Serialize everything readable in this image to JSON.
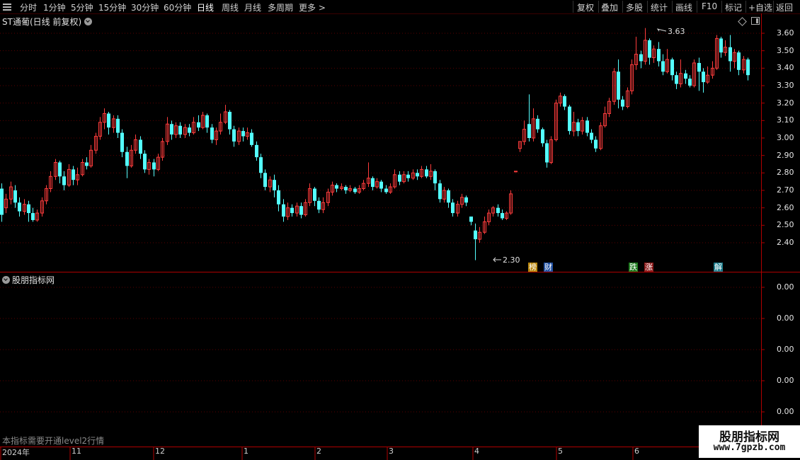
{
  "toolbar": {
    "periods": [
      "分时",
      "1分钟",
      "5分钟",
      "15分钟",
      "30分钟",
      "60分钟",
      "日线",
      "周线",
      "月线",
      "多周期",
      "更多 >"
    ],
    "active_period": "日线",
    "actions": [
      "复权",
      "叠加",
      "多股",
      "统计",
      "画线",
      "F10",
      "标记",
      "+自选",
      "返回"
    ]
  },
  "main_chart": {
    "title": "ST通葡(日线 前复权)",
    "y_ticks": [
      "3.60",
      "3.50",
      "3.40",
      "3.30",
      "3.20",
      "3.10",
      "3.00",
      "2.90",
      "2.80",
      "2.70",
      "2.60",
      "2.50",
      "2.40"
    ],
    "high_label": "3.63",
    "low_label": "2.30",
    "events": [
      {
        "text": "榜",
        "color": "#b8860b"
      },
      {
        "text": "财",
        "color": "#1f4fa0"
      },
      {
        "text": "跌",
        "color": "#1e7a1e"
      },
      {
        "text": "涨",
        "color": "#8b1a1a"
      },
      {
        "text": "解",
        "color": "#1a7a8a"
      }
    ],
    "up_color": "#ff3c3c",
    "down_color": "#54ffff"
  },
  "indicator": {
    "title": "股朋指标网",
    "y_ticks": [
      "0.00",
      "0.00",
      "0.00",
      "0.00",
      "0.00"
    ],
    "note": "本指标需要开通level2行情"
  },
  "dates": [
    "2024年",
    "11",
    "12",
    "1",
    "2",
    "3",
    "4",
    "5",
    "6"
  ],
  "watermark": {
    "title": "股朋指标网",
    "url": "www.7gpzb.com"
  },
  "chart_data": {
    "type": "candlestick",
    "ylim": [
      2.3,
      3.63
    ],
    "candles": [
      [
        2.71,
        2.56,
        2.74,
        2.52
      ],
      [
        2.6,
        2.65,
        2.68,
        2.57
      ],
      [
        2.65,
        2.72,
        2.75,
        2.62
      ],
      [
        2.7,
        2.63,
        2.73,
        2.6
      ],
      [
        2.63,
        2.58,
        2.66,
        2.55
      ],
      [
        2.58,
        2.62,
        2.65,
        2.56
      ],
      [
        2.62,
        2.57,
        2.64,
        2.52
      ],
      [
        2.57,
        2.53,
        2.6,
        2.52
      ],
      [
        2.53,
        2.57,
        2.59,
        2.52
      ],
      [
        2.57,
        2.64,
        2.66,
        2.55
      ],
      [
        2.64,
        2.71,
        2.73,
        2.62
      ],
      [
        2.71,
        2.78,
        2.81,
        2.69
      ],
      [
        2.78,
        2.86,
        2.88,
        2.76
      ],
      [
        2.86,
        2.78,
        2.87,
        2.74
      ],
      [
        2.78,
        2.73,
        2.81,
        2.7
      ],
      [
        2.73,
        2.82,
        2.85,
        2.72
      ],
      [
        2.82,
        2.76,
        2.84,
        2.73
      ],
      [
        2.76,
        2.79,
        2.83,
        2.73
      ],
      [
        2.79,
        2.86,
        2.88,
        2.78
      ],
      [
        2.86,
        2.84,
        2.89,
        2.82
      ],
      [
        2.84,
        2.93,
        2.96,
        2.83
      ],
      [
        2.93,
        3.01,
        3.03,
        2.91
      ],
      [
        3.01,
        3.09,
        3.12,
        2.99
      ],
      [
        3.09,
        3.14,
        3.17,
        3.05
      ],
      [
        3.14,
        3.06,
        3.15,
        3.02
      ],
      [
        3.06,
        3.11,
        3.13,
        3.03
      ],
      [
        3.11,
        3.03,
        3.13,
        3.0
      ],
      [
        3.03,
        2.92,
        3.05,
        2.89
      ],
      [
        2.92,
        2.84,
        2.95,
        2.77
      ],
      [
        2.84,
        2.93,
        2.96,
        2.83
      ],
      [
        2.93,
        2.99,
        3.02,
        2.91
      ],
      [
        2.99,
        2.91,
        3.01,
        2.88
      ],
      [
        2.91,
        2.82,
        2.93,
        2.8
      ],
      [
        2.82,
        2.86,
        2.88,
        2.79
      ],
      [
        2.86,
        2.82,
        2.88,
        2.78
      ],
      [
        2.82,
        2.89,
        2.91,
        2.81
      ],
      [
        2.89,
        2.98,
        3.0,
        2.87
      ],
      [
        2.98,
        3.08,
        3.12,
        2.96
      ],
      [
        3.08,
        3.02,
        3.1,
        2.99
      ],
      [
        3.02,
        3.07,
        3.09,
        3.0
      ],
      [
        3.07,
        3.02,
        3.09,
        3.0
      ],
      [
        3.02,
        3.06,
        3.08,
        3.0
      ],
      [
        3.06,
        3.03,
        3.08,
        3.01
      ],
      [
        3.03,
        3.09,
        3.12,
        3.02
      ],
      [
        3.09,
        3.06,
        3.13,
        3.04
      ],
      [
        3.06,
        3.13,
        3.15,
        3.05
      ],
      [
        3.13,
        3.06,
        3.14,
        3.03
      ],
      [
        3.06,
        2.99,
        3.08,
        2.97
      ],
      [
        2.99,
        3.04,
        3.06,
        2.96
      ],
      [
        3.04,
        3.09,
        3.14,
        3.02
      ],
      [
        3.09,
        3.15,
        3.19,
        3.08
      ],
      [
        3.15,
        3.05,
        3.16,
        3.02
      ],
      [
        3.05,
        2.98,
        3.07,
        2.95
      ],
      [
        2.98,
        3.04,
        3.06,
        2.96
      ],
      [
        3.04,
        3.01,
        3.06,
        2.98
      ],
      [
        3.01,
        3.03,
        3.06,
        2.99
      ],
      [
        3.03,
        2.96,
        3.05,
        2.95
      ],
      [
        2.96,
        2.89,
        2.98,
        2.87
      ],
      [
        2.89,
        2.8,
        2.91,
        2.77
      ],
      [
        2.8,
        2.72,
        2.82,
        2.7
      ],
      [
        2.72,
        2.76,
        2.78,
        2.69
      ],
      [
        2.76,
        2.7,
        2.79,
        2.66
      ],
      [
        2.7,
        2.62,
        2.73,
        2.58
      ],
      [
        2.62,
        2.55,
        2.65,
        2.52
      ],
      [
        2.55,
        2.6,
        2.63,
        2.53
      ],
      [
        2.6,
        2.57,
        2.62,
        2.55
      ],
      [
        2.57,
        2.61,
        2.63,
        2.55
      ],
      [
        2.61,
        2.56,
        2.63,
        2.54
      ],
      [
        2.56,
        2.63,
        2.65,
        2.55
      ],
      [
        2.63,
        2.71,
        2.74,
        2.61
      ],
      [
        2.71,
        2.64,
        2.72,
        2.61
      ],
      [
        2.64,
        2.59,
        2.66,
        2.57
      ],
      [
        2.59,
        2.63,
        2.66,
        2.57
      ],
      [
        2.63,
        2.69,
        2.71,
        2.61
      ],
      [
        2.69,
        2.73,
        2.75,
        2.67
      ],
      [
        2.73,
        2.71,
        2.74,
        2.69
      ],
      [
        2.71,
        2.72,
        2.74,
        2.7
      ],
      [
        2.72,
        2.7,
        2.73,
        2.68
      ],
      [
        2.7,
        2.71,
        2.73,
        2.69
      ],
      [
        2.71,
        2.69,
        2.72,
        2.68
      ],
      [
        2.69,
        2.71,
        2.73,
        2.68
      ],
      [
        2.71,
        2.74,
        2.76,
        2.7
      ],
      [
        2.74,
        2.77,
        2.86,
        2.72
      ],
      [
        2.77,
        2.72,
        2.78,
        2.7
      ],
      [
        2.72,
        2.75,
        2.77,
        2.71
      ],
      [
        2.75,
        2.71,
        2.76,
        2.69
      ],
      [
        2.71,
        2.69,
        2.73,
        2.68
      ],
      [
        2.69,
        2.72,
        2.74,
        2.68
      ],
      [
        2.72,
        2.79,
        2.82,
        2.71
      ],
      [
        2.79,
        2.75,
        2.81,
        2.73
      ],
      [
        2.75,
        2.79,
        2.81,
        2.74
      ],
      [
        2.79,
        2.77,
        2.81,
        2.75
      ],
      [
        2.77,
        2.8,
        2.82,
        2.76
      ],
      [
        2.8,
        2.78,
        2.82,
        2.76
      ],
      [
        2.78,
        2.82,
        2.84,
        2.77
      ],
      [
        2.82,
        2.78,
        2.84,
        2.77
      ],
      [
        2.78,
        2.81,
        2.85,
        2.76
      ],
      [
        2.81,
        2.74,
        2.82,
        2.7
      ],
      [
        2.74,
        2.65,
        2.76,
        2.63
      ],
      [
        2.65,
        2.7,
        2.72,
        2.63
      ],
      [
        2.7,
        2.63,
        2.71,
        2.6
      ],
      [
        2.63,
        2.57,
        2.65,
        2.55
      ],
      [
        2.57,
        2.62,
        2.64,
        2.55
      ],
      [
        2.62,
        2.66,
        2.68,
        2.6
      ],
      [
        2.66,
        2.63,
        2.67,
        2.61
      ],
      [
        2.55,
        2.52,
        2.55,
        2.5
      ],
      [
        2.47,
        2.42,
        2.51,
        2.3
      ],
      [
        2.42,
        2.46,
        2.49,
        2.4
      ],
      [
        2.46,
        2.52,
        2.55,
        2.45
      ],
      [
        2.52,
        2.57,
        2.59,
        2.5
      ],
      [
        2.57,
        2.6,
        2.61,
        2.55
      ],
      [
        2.6,
        2.57,
        2.62,
        2.55
      ],
      [
        2.57,
        2.54,
        2.59,
        2.53
      ],
      [
        2.54,
        2.57,
        2.58,
        2.53
      ],
      [
        2.57,
        2.68,
        2.7,
        2.56
      ],
      [
        2.81,
        2.81,
        2.81,
        2.81
      ],
      [
        2.94,
        2.98,
        2.98,
        2.92
      ],
      [
        2.98,
        3.05,
        3.1,
        2.96
      ],
      [
        3.08,
        3.0,
        3.25,
        2.98
      ],
      [
        3.0,
        3.11,
        3.17,
        2.98
      ],
      [
        3.11,
        3.05,
        3.13,
        3.03
      ],
      [
        3.05,
        2.97,
        3.06,
        2.95
      ],
      [
        2.97,
        2.86,
        2.99,
        2.83
      ],
      [
        2.86,
        2.99,
        3.01,
        2.85
      ],
      [
        2.99,
        3.2,
        3.22,
        2.98
      ],
      [
        3.2,
        3.24,
        3.26,
        3.18
      ],
      [
        3.24,
        3.18,
        3.25,
        3.16
      ],
      [
        3.18,
        3.04,
        3.19,
        3.02
      ],
      [
        3.04,
        3.09,
        3.15,
        3.01
      ],
      [
        3.09,
        3.04,
        3.11,
        3.01
      ],
      [
        3.04,
        3.1,
        3.12,
        3.02
      ],
      [
        3.1,
        3.03,
        3.12,
        3.01
      ],
      [
        3.03,
        2.99,
        3.05,
        2.97
      ],
      [
        2.99,
        2.94,
        3.01,
        2.92
      ],
      [
        2.94,
        3.07,
        3.09,
        2.93
      ],
      [
        3.07,
        3.14,
        3.18,
        3.06
      ],
      [
        3.14,
        3.21,
        3.23,
        3.12
      ],
      [
        3.21,
        3.38,
        3.4,
        3.19
      ],
      [
        3.38,
        3.22,
        3.45,
        3.17
      ],
      [
        3.22,
        3.18,
        3.24,
        3.16
      ],
      [
        3.18,
        3.27,
        3.29,
        3.17
      ],
      [
        3.27,
        3.42,
        3.45,
        3.25
      ],
      [
        3.42,
        3.48,
        3.58,
        3.39
      ],
      [
        3.48,
        3.44,
        3.5,
        3.4
      ],
      [
        3.44,
        3.56,
        3.63,
        3.42
      ],
      [
        3.56,
        3.46,
        3.57,
        3.42
      ],
      [
        3.46,
        3.51,
        3.53,
        3.43
      ],
      [
        3.51,
        3.44,
        3.55,
        3.41
      ],
      [
        3.44,
        3.38,
        3.48,
        3.36
      ],
      [
        3.38,
        3.45,
        3.51,
        3.37
      ],
      [
        3.45,
        3.36,
        3.46,
        3.33
      ],
      [
        3.36,
        3.31,
        3.38,
        3.28
      ],
      [
        3.31,
        3.37,
        3.45,
        3.29
      ],
      [
        3.37,
        3.34,
        3.39,
        3.31
      ],
      [
        3.34,
        3.3,
        3.36,
        3.29
      ],
      [
        3.3,
        3.43,
        3.45,
        3.29
      ],
      [
        3.43,
        3.38,
        3.46,
        3.27
      ],
      [
        3.38,
        3.32,
        3.4,
        3.26
      ],
      [
        3.32,
        3.36,
        3.41,
        3.31
      ],
      [
        3.36,
        3.4,
        3.44,
        3.34
      ],
      [
        3.4,
        3.57,
        3.59,
        3.39
      ],
      [
        3.57,
        3.49,
        3.58,
        3.46
      ],
      [
        3.49,
        3.52,
        3.56,
        3.47
      ],
      [
        3.52,
        3.44,
        3.59,
        3.38
      ],
      [
        3.44,
        3.49,
        3.51,
        3.4
      ],
      [
        3.49,
        3.39,
        3.5,
        3.36
      ],
      [
        3.39,
        3.45,
        3.47,
        3.37
      ],
      [
        3.45,
        3.36,
        3.46,
        3.33
      ]
    ]
  }
}
